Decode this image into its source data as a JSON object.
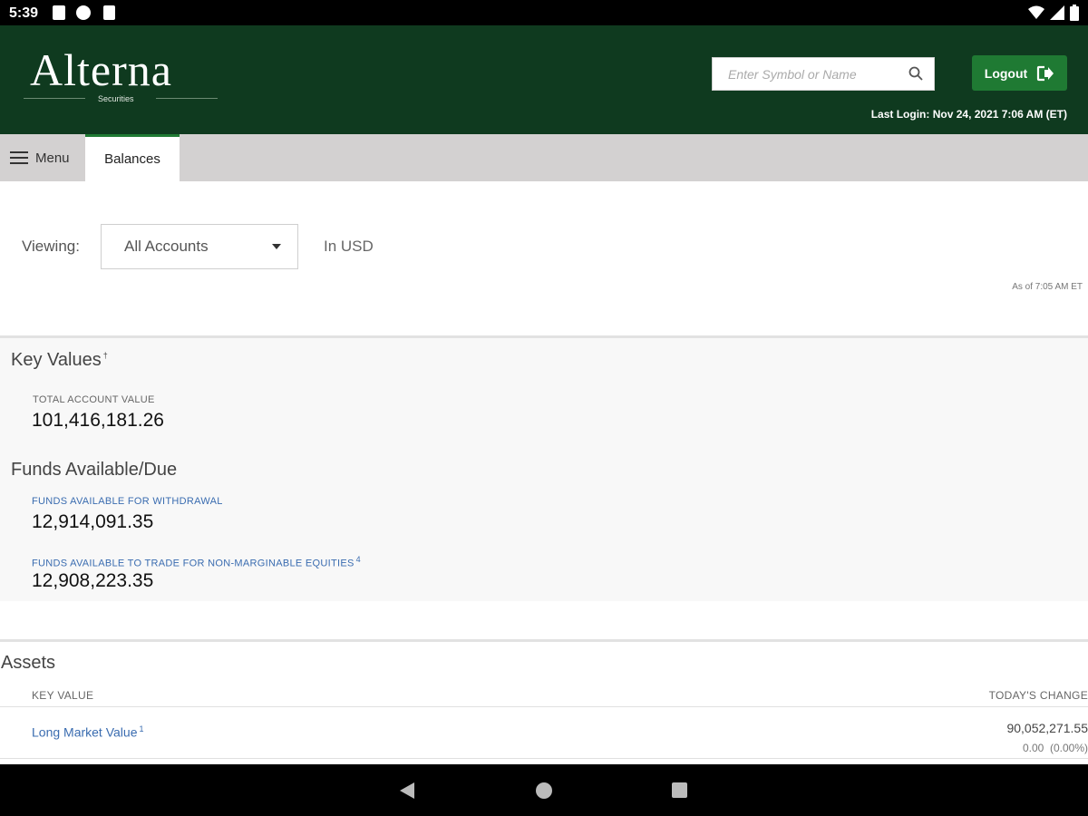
{
  "status_bar": {
    "time": "5:39"
  },
  "header": {
    "brand": "Alterna",
    "brand_sub": "Securities",
    "search_placeholder": "Enter Symbol or Name",
    "logout_label": "Logout",
    "last_login": "Last Login: Nov 24, 2021 7:06 AM (ET)",
    "bg_color": "#0f3a1f",
    "accent_color": "#1f7a33"
  },
  "tabs": {
    "menu_label": "Menu",
    "active_tab": "Balances"
  },
  "viewing": {
    "label": "Viewing:",
    "selected_account": "All Accounts",
    "currency": "In USD",
    "as_of": "As of 7:05 AM ET"
  },
  "key_values": {
    "title": "Key Values",
    "title_sup": "†",
    "total_label": "TOTAL ACCOUNT VALUE",
    "total_value": "101,416,181.26"
  },
  "funds": {
    "title": "Funds Available/Due",
    "withdrawal_label": "FUNDS AVAILABLE FOR WITHDRAWAL",
    "withdrawal_value": "12,914,091.35",
    "trade_label": "FUNDS AVAILABLE TO TRADE FOR NON-MARGINABLE EQUITIES",
    "trade_sup": "4",
    "trade_value": "12,908,223.35"
  },
  "assets": {
    "title": "Assets",
    "col_key": "KEY VALUE",
    "col_change": "TODAY'S CHANGE",
    "rows": [
      {
        "label": "Long Market Value",
        "sup": "1",
        "value": "90,052,271.55",
        "change": "0.00",
        "change_pct": "(0.00%)"
      }
    ]
  }
}
